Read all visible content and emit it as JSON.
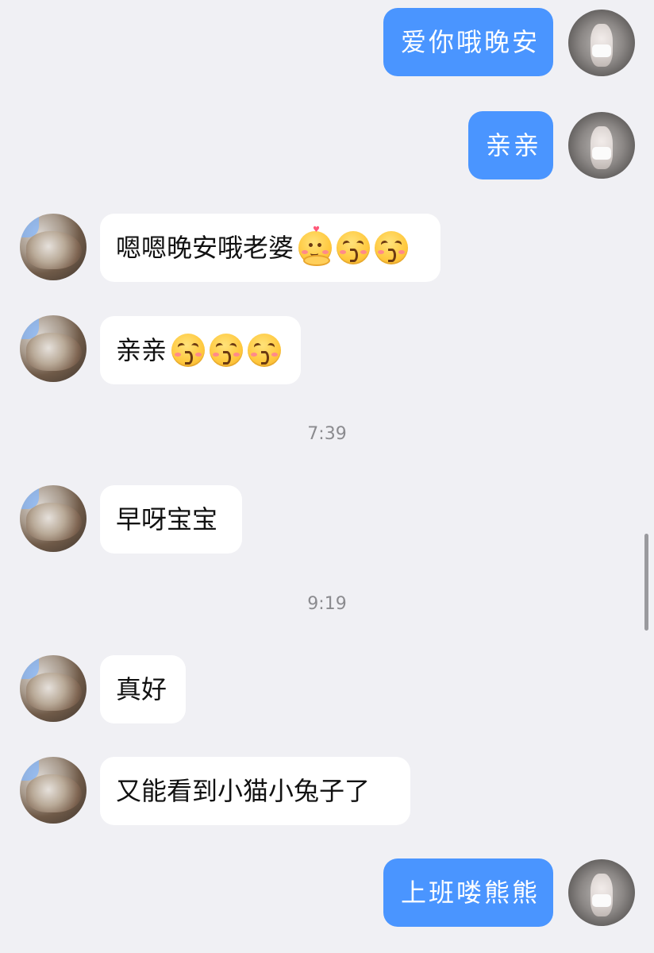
{
  "messages": [
    {
      "sender": "me",
      "text": "爱你哦晚安"
    },
    {
      "sender": "me",
      "text": "亲亲"
    },
    {
      "sender": "other",
      "text": "嗯嗯晚安哦老婆",
      "emojis": [
        "shy-hug-emoji",
        "kiss-emoji",
        "kiss-emoji"
      ]
    },
    {
      "sender": "other",
      "text": "亲亲",
      "emojis": [
        "kiss-emoji",
        "kiss-emoji",
        "kiss-emoji"
      ]
    },
    {
      "sender": "other",
      "text": "早呀宝宝"
    },
    {
      "sender": "other",
      "text": "真好"
    },
    {
      "sender": "other",
      "text": "又能看到小猫小兔子了"
    },
    {
      "sender": "me",
      "text": "上班喽熊熊"
    }
  ],
  "timestamps": [
    "7:39",
    "9:19"
  ],
  "colors": {
    "background": "#f0f0f4",
    "my_bubble": "#4a95ff",
    "other_bubble": "#ffffff",
    "timestamp_text": "#8b8b8f"
  }
}
